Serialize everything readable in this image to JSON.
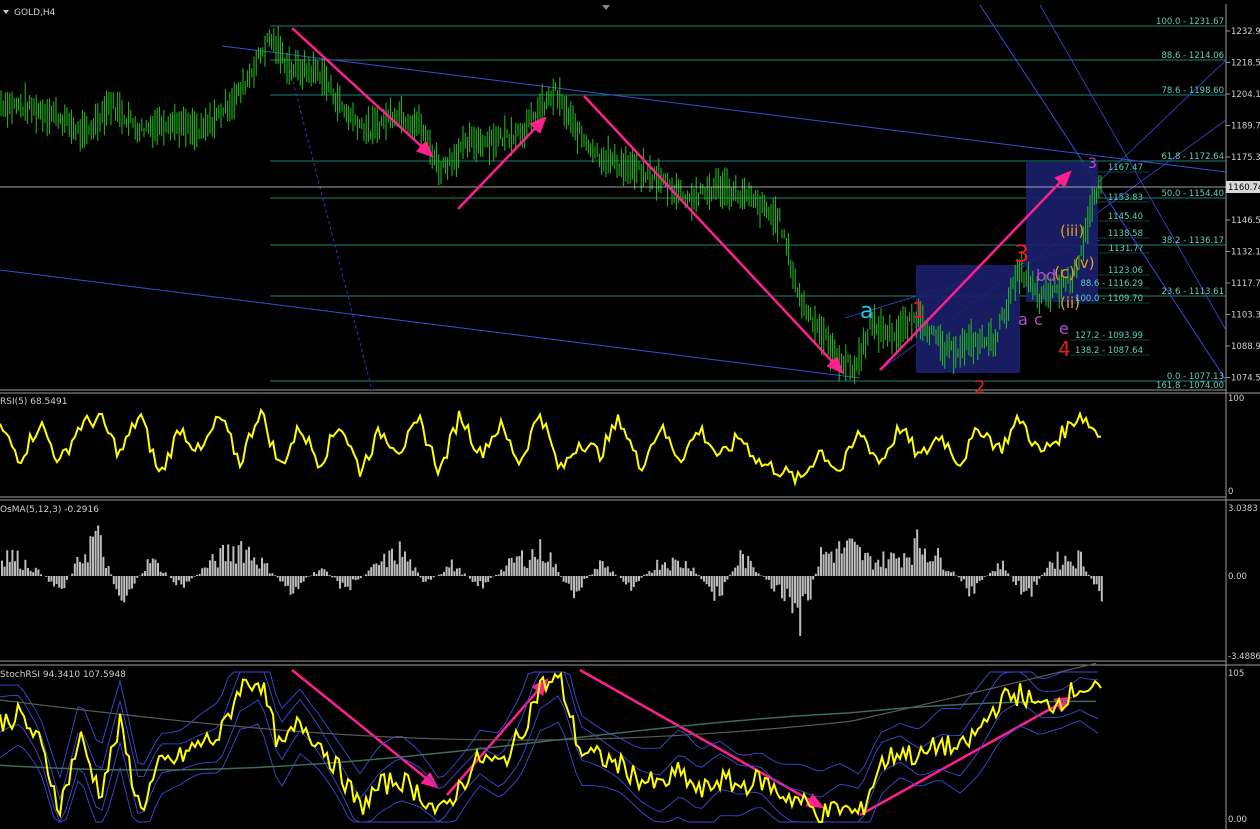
{
  "symbol": "GOLD,H4",
  "colors": {
    "background": "#000000",
    "candles": "#22c21d",
    "fib": "#1f7f78",
    "channel": "#3a4cd8",
    "arrow": "#ff1f8f",
    "rsi": "#ffff00",
    "osma": "#bdbdbd",
    "box": "#1b1f6a",
    "current_price": "#d8d8d8"
  },
  "price_axis": {
    "ticks": [
      "1232.90",
      "1218.55",
      "1204.10",
      "1189.70",
      "1175.30",
      "1146.50",
      "1132.10",
      "1117.70",
      "1103.30",
      "1088.90",
      "1074.50"
    ],
    "current": "1160.74"
  },
  "fib_levels": [
    {
      "label": "100.0 - 1231.67"
    },
    {
      "label": "88.6 - 1214.06"
    },
    {
      "label": "78.6 - 1198.60"
    },
    {
      "label": "61.8 - 1172.64"
    },
    {
      "label": "50.0 - 1154.40"
    },
    {
      "label": "38.2 - 1136.17"
    },
    {
      "label": "23.6 - 1113.61"
    },
    {
      "label": "0.0 - 1077.13"
    },
    {
      "label": "161.8 - 1074.00"
    }
  ],
  "fib_small": [
    {
      "label": "1167.47"
    },
    {
      "label": "1153.83"
    },
    {
      "label": "1145.40"
    },
    {
      "label": "1138.58"
    },
    {
      "label": "1131.7?"
    },
    {
      "label": "1123.06"
    },
    {
      "label": "88.6 - 1116.29"
    },
    {
      "label": "100.0 - 1109.70"
    },
    {
      "label": "127.2 - 1093.99"
    },
    {
      "label": "138.2 - 1087.64"
    }
  ],
  "wave_labels": [
    {
      "text": "a",
      "color": "#22c8e8"
    },
    {
      "text": "1",
      "color": "#d82020"
    },
    {
      "text": "3",
      "color": "#e02020"
    },
    {
      "text": "b",
      "color": "#b050d0"
    },
    {
      "text": "d",
      "color": "#b050d0"
    },
    {
      "text": "(c)",
      "color": "#e0a020"
    },
    {
      "text": "(v)",
      "color": "#e0a020"
    },
    {
      "text": "(iii)",
      "color": "#e0a020"
    },
    {
      "text": "(ii)",
      "color": "#e0a020"
    },
    {
      "text": "a",
      "color": "#b050d0"
    },
    {
      "text": "c",
      "color": "#b050d0"
    },
    {
      "text": "e",
      "color": "#b050d0"
    },
    {
      "text": "4",
      "color": "#e02020"
    },
    {
      "text": "2",
      "color": "#e02020"
    },
    {
      "text": "3",
      "color": "#b050d0"
    }
  ],
  "rsi": {
    "label": "RSI(5) 68.5491",
    "max": "100",
    "min": "0"
  },
  "osma": {
    "label": "OsMA(5,12,3) -0.2916",
    "max": "3.0383",
    "zero": "0.00",
    "min": "-3.4886"
  },
  "stochrsi": {
    "label": "StochRSI 94.3410 107.5948",
    "max": "105",
    "min": "0.00"
  },
  "chart_data": [
    {
      "type": "line",
      "title": "GOLD,H4",
      "ylim": [
        1072,
        1237
      ],
      "y_ticks": [
        1232.9,
        1218.55,
        1204.1,
        1189.7,
        1175.3,
        1146.5,
        1132.1,
        1117.7,
        1103.3,
        1088.9,
        1074.5
      ],
      "series": [
        {
          "x": [
            0,
            25,
            55,
            85,
            110,
            140,
            170,
            200,
            240,
            270,
            290,
            320,
            345,
            370,
            395,
            420,
            440,
            470,
            500,
            525,
            555,
            575,
            600,
            630,
            660,
            690,
            720,
            750,
            780,
            800,
            815,
            835,
            855,
            870,
            895,
            920,
            945,
            970,
            995,
            1020,
            1040,
            1060,
            1075,
            1090,
            1100
          ],
          "values": [
            1200,
            1198,
            1195,
            1185,
            1200,
            1188,
            1192,
            1186,
            1205,
            1230,
            1216,
            1214,
            1196,
            1187,
            1196,
            1190,
            1170,
            1182,
            1184,
            1188,
            1205,
            1188,
            1176,
            1170,
            1165,
            1156,
            1162,
            1156,
            1146,
            1110,
            1100,
            1085,
            1078,
            1098,
            1094,
            1103,
            1086,
            1090,
            1092,
            1124,
            1110,
            1116,
            1122,
            1150,
            1160
          ]
        }
      ]
    },
    {
      "type": "line",
      "title": "RSI(5) 68.5491",
      "ylim": [
        0,
        100
      ],
      "series": [
        {
          "x": [
            0,
            20,
            40,
            60,
            80,
            100,
            120,
            140,
            160,
            180,
            200,
            220,
            240,
            260,
            280,
            300,
            320,
            340,
            360,
            380,
            400,
            420,
            440,
            460,
            480,
            500,
            520,
            540,
            560,
            580,
            600,
            620,
            640,
            660,
            680,
            700,
            720,
            740,
            760,
            780,
            800,
            820,
            840,
            860,
            880,
            900,
            920,
            940,
            960,
            980,
            1000,
            1020,
            1040,
            1060,
            1080,
            1100
          ],
          "values": [
            70,
            35,
            75,
            30,
            72,
            80,
            40,
            85,
            15,
            70,
            40,
            82,
            30,
            90,
            25,
            70,
            30,
            75,
            22,
            65,
            45,
            75,
            20,
            85,
            40,
            72,
            30,
            88,
            20,
            55,
            40,
            80,
            25,
            70,
            35,
            68,
            35,
            60,
            30,
            22,
            10,
            45,
            20,
            65,
            30,
            70,
            35,
            62,
            30,
            70,
            45,
            80,
            40,
            60,
            85,
            60
          ]
        }
      ]
    },
    {
      "type": "bar",
      "title": "OsMA(5,12,3) -0.2916",
      "ylim": [
        -3.4886,
        3.0383
      ],
      "series": [
        {
          "x": [
            5,
            30,
            60,
            95,
            120,
            150,
            180,
            210,
            240,
            265,
            290,
            320,
            345,
            375,
            400,
            425,
            450,
            480,
            515,
            545,
            570,
            600,
            630,
            660,
            690,
            715,
            740,
            770,
            800,
            820,
            850,
            870,
            895,
            920,
            945,
            970,
            1000,
            1025,
            1050,
            1080,
            1100
          ],
          "values": [
            1.4,
            0.6,
            -0.8,
            2.5,
            -1.5,
            1.0,
            -0.7,
            0.8,
            1.9,
            0.6,
            -0.9,
            0.5,
            -0.8,
            0.6,
            1.5,
            -0.5,
            0.7,
            -0.6,
            1.0,
            1.6,
            -1.2,
            0.8,
            -0.6,
            0.9,
            0.7,
            -1.4,
            1.2,
            -0.5,
            -3.0,
            1.3,
            1.7,
            0.9,
            1.1,
            2.0,
            0.7,
            -0.9,
            0.8,
            -1.3,
            0.9,
            1.1,
            -1.3
          ]
        }
      ]
    },
    {
      "type": "line",
      "title": "StochRSI 94.3410 107.5948",
      "ylim": [
        0,
        105
      ],
      "series": [
        {
          "x": [
            0,
            20,
            40,
            60,
            80,
            100,
            120,
            140,
            160,
            180,
            200,
            220,
            240,
            260,
            280,
            300,
            320,
            340,
            360,
            380,
            400,
            420,
            440,
            460,
            480,
            500,
            520,
            540,
            560,
            580,
            600,
            620,
            640,
            660,
            680,
            700,
            720,
            740,
            760,
            780,
            800,
            820,
            840,
            860,
            880,
            900,
            920,
            940,
            960,
            980,
            1000,
            1020,
            1040,
            1060,
            1080,
            1100
          ],
          "values": [
            70,
            75,
            55,
            10,
            60,
            20,
            68,
            8,
            40,
            45,
            55,
            60,
            95,
            100,
            50,
            70,
            55,
            35,
            10,
            25,
            30,
            20,
            5,
            25,
            45,
            40,
            60,
            95,
            100,
            50,
            45,
            40,
            30,
            25,
            35,
            20,
            30,
            25,
            30,
            20,
            15,
            5,
            10,
            5,
            40,
            50,
            45,
            55,
            50,
            65,
            85,
            90,
            80,
            85,
            95,
            90
          ]
        }
      ]
    }
  ]
}
